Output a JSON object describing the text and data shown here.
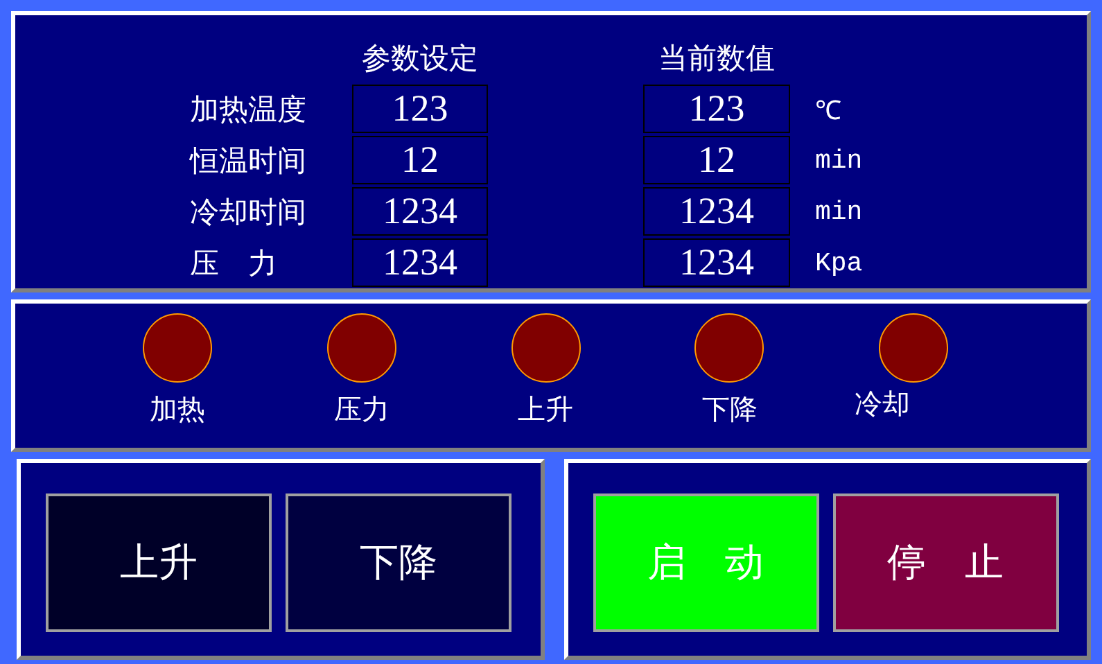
{
  "parameters": {
    "set_header": "参数设定",
    "current_header": "当前数值",
    "rows": [
      {
        "label": "加热温度",
        "set_value": "123",
        "current_value": "123",
        "unit": "℃"
      },
      {
        "label": "恒温时间",
        "set_value": "12",
        "current_value": "12",
        "unit": "min"
      },
      {
        "label": "冷却时间",
        "set_value": "1234",
        "current_value": "1234",
        "unit": "min"
      },
      {
        "label": "压　力",
        "set_value": "1234",
        "current_value": "1234",
        "unit": "Kpa"
      }
    ]
  },
  "indicators": [
    {
      "label": "加热",
      "on": false
    },
    {
      "label": "压力",
      "on": false
    },
    {
      "label": "上升",
      "on": false
    },
    {
      "label": "下降",
      "on": false
    },
    {
      "label": "冷却",
      "on": false
    }
  ],
  "motion_buttons": [
    {
      "label": "上升",
      "color": "#000028"
    },
    {
      "label": "下降",
      "color": "#000040"
    }
  ],
  "control_buttons": [
    {
      "label": "启　动",
      "color": "#00ff00"
    },
    {
      "label": "停　止",
      "color": "#800040"
    }
  ]
}
